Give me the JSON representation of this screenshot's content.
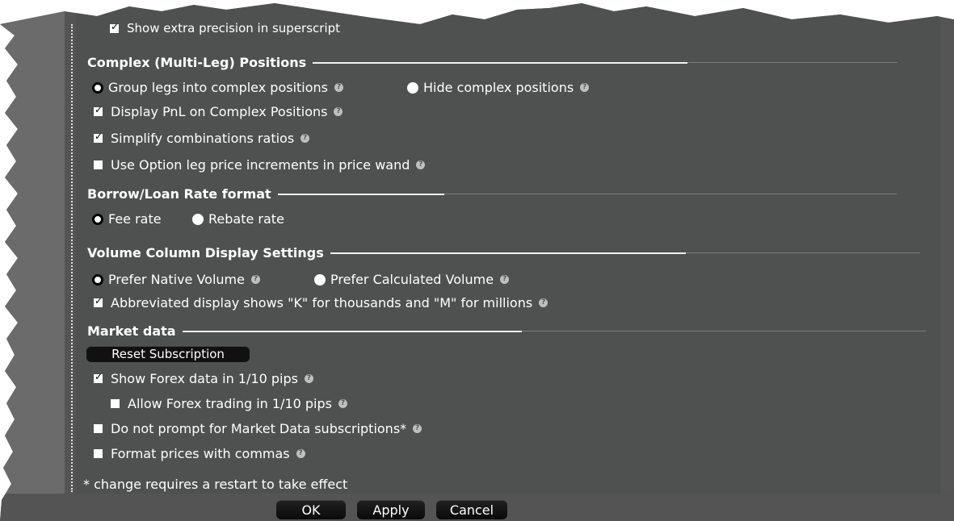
{
  "top": {
    "partial_text": "Show extra precision in superscript",
    "partial_checked": true
  },
  "complex": {
    "title": "Complex (Multi-Leg) Positions",
    "radio_group": "Group legs into complex positions",
    "radio_hide": "Hide complex positions",
    "display_pnl": "Display PnL on Complex Positions",
    "simplify": "Simplify combinations ratios",
    "option_leg": "Use Option leg price increments in price wand"
  },
  "borrow": {
    "title": "Borrow/Loan Rate format",
    "fee": "Fee rate",
    "rebate": "Rebate rate"
  },
  "volume": {
    "title": "Volume Column Display Settings",
    "native": "Prefer Native Volume",
    "calculated": "Prefer Calculated Volume",
    "abbreviated": "Abbreviated display shows \"K\" for thousands and \"M\" for millions"
  },
  "market": {
    "title": "Market data",
    "reset_button": "Reset Subscription",
    "forex_pips": "Show Forex data in 1/10 pips",
    "allow_forex": "Allow Forex trading in 1/10 pips",
    "no_prompt": "Do not prompt for Market Data subscriptions*",
    "commas": "Format prices with commas"
  },
  "footer": {
    "note": "* change requires a restart to take effect",
    "ok": "OK",
    "apply": "Apply",
    "cancel": "Cancel"
  },
  "colors": {
    "panel_bg": "#4f5050",
    "button_bg": "#111111",
    "text": "#ffffff"
  },
  "icons": [
    "help-icon",
    "check-icon"
  ]
}
